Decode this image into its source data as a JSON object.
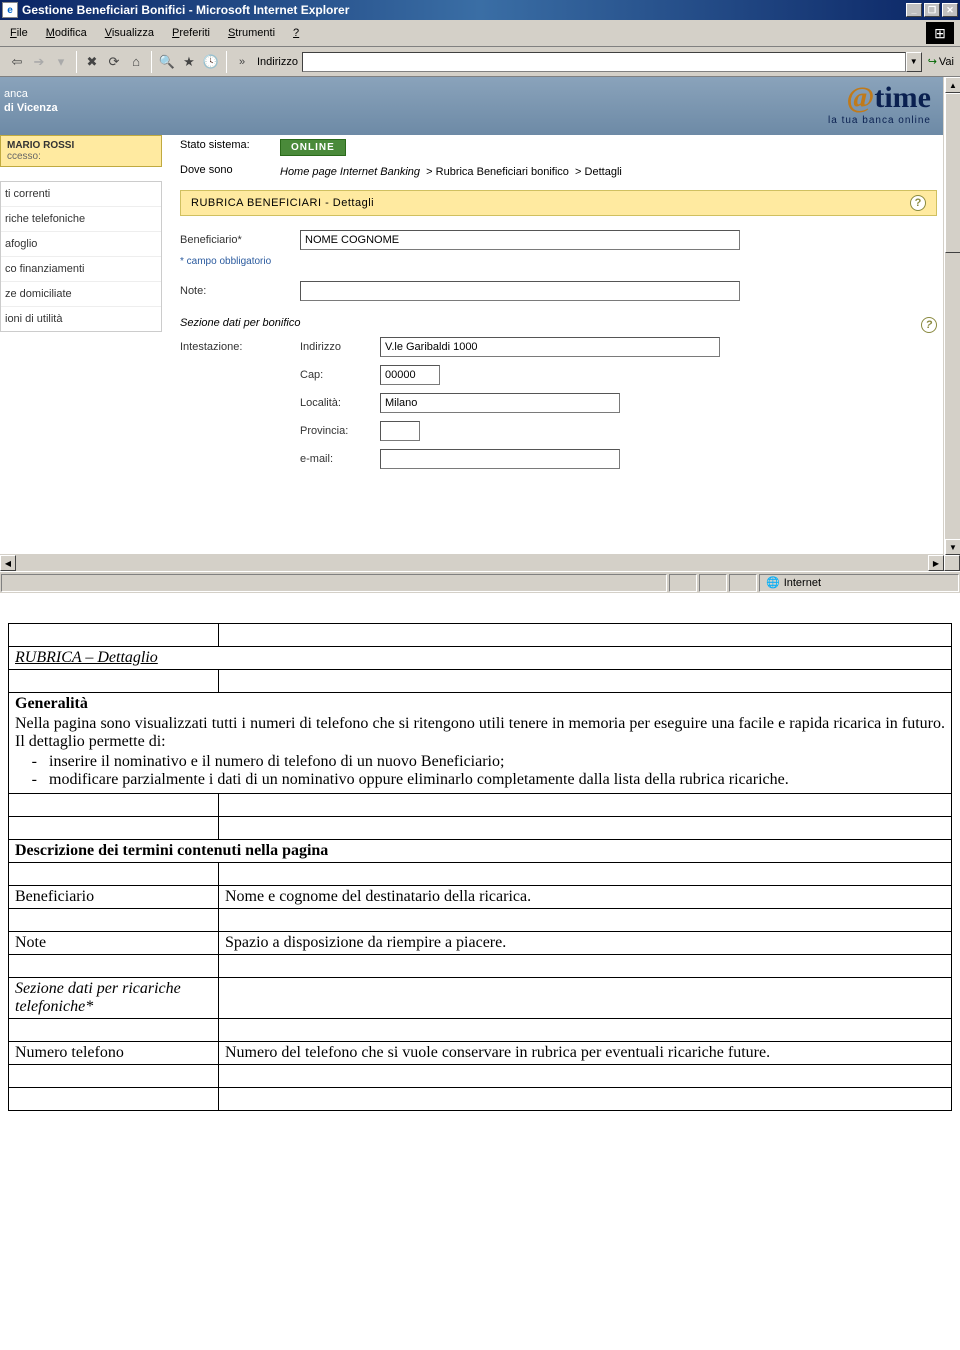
{
  "window": {
    "title": "Gestione Beneficiari Bonifici - Microsoft Internet Explorer",
    "menus": [
      "File",
      "Modifica",
      "Visualizza",
      "Preferiti",
      "Strumenti",
      "?"
    ],
    "address_label": "Indirizzo",
    "address_value": "",
    "go_label": "Vai",
    "status_zone": "Internet"
  },
  "bank_header": {
    "line1": "anca",
    "line2": "di Vicenza",
    "logo": "time",
    "tagline": "la tua banca online"
  },
  "user": {
    "name": "MARIO ROSSI",
    "access_label": "ccesso:"
  },
  "sidebar": {
    "items": [
      "ti correnti",
      "riche telefoniche",
      "afoglio",
      "co finanziamenti",
      "ze domiciliate",
      "ioni di utilità"
    ]
  },
  "status": {
    "system_label": "Stato sistema:",
    "system_value": "ONLINE",
    "where_label": "Dove sono",
    "breadcrumb_home": "Home page Internet Banking",
    "breadcrumb_mid": "Rubrica Beneficiari bonifico",
    "breadcrumb_last": "Dettagli"
  },
  "panel": {
    "title": "RUBRICA BENEFICIARI - Dettagli"
  },
  "form": {
    "beneficiario_label": "Beneficiario*",
    "beneficiario_value": "NOME COGNOME",
    "required_note": "* campo obbligatorio",
    "note_label": "Note:",
    "note_value": "",
    "section_label": "Sezione dati per bonifico",
    "intestazione_label": "Intestazione:",
    "indirizzo_label": "Indirizzo",
    "indirizzo_value": "V.le Garibaldi 1000",
    "cap_label": "Cap:",
    "cap_value": "00000",
    "localita_label": "Località:",
    "localita_value": "Milano",
    "provincia_label": "Provincia:",
    "provincia_value": "",
    "email_label": "e-mail:",
    "email_value": ""
  },
  "doc": {
    "heading": "RUBRICA – Dettaglio",
    "gen_title": "Generalità",
    "gen_p1": "Nella pagina sono visualizzati tutti i numeri di telefono che si ritengono utili tenere in memoria per eseguire una facile e rapida ricarica in futuro. Il dettaglio permette di:",
    "gen_li1": "inserire il nominativo e il numero di telefono di un nuovo Beneficiario;",
    "gen_li2": "modificare parzialmente i dati di un nominativo oppure eliminarlo completamente dalla lista della rubrica ricariche.",
    "desc_title": "Descrizione dei termini contenuti nella pagina",
    "r1_k": "Beneficiario",
    "r1_v": "Nome e cognome del destinatario della ricarica.",
    "r2_k": "Note",
    "r2_v": "Spazio a disposizione da riempire a piacere.",
    "r3_k": "Sezione dati per ricariche telefoniche*",
    "r4_k": "Numero telefono",
    "r4_v": "Numero del telefono che si vuole conservare in rubrica per eventuali ricariche future."
  }
}
